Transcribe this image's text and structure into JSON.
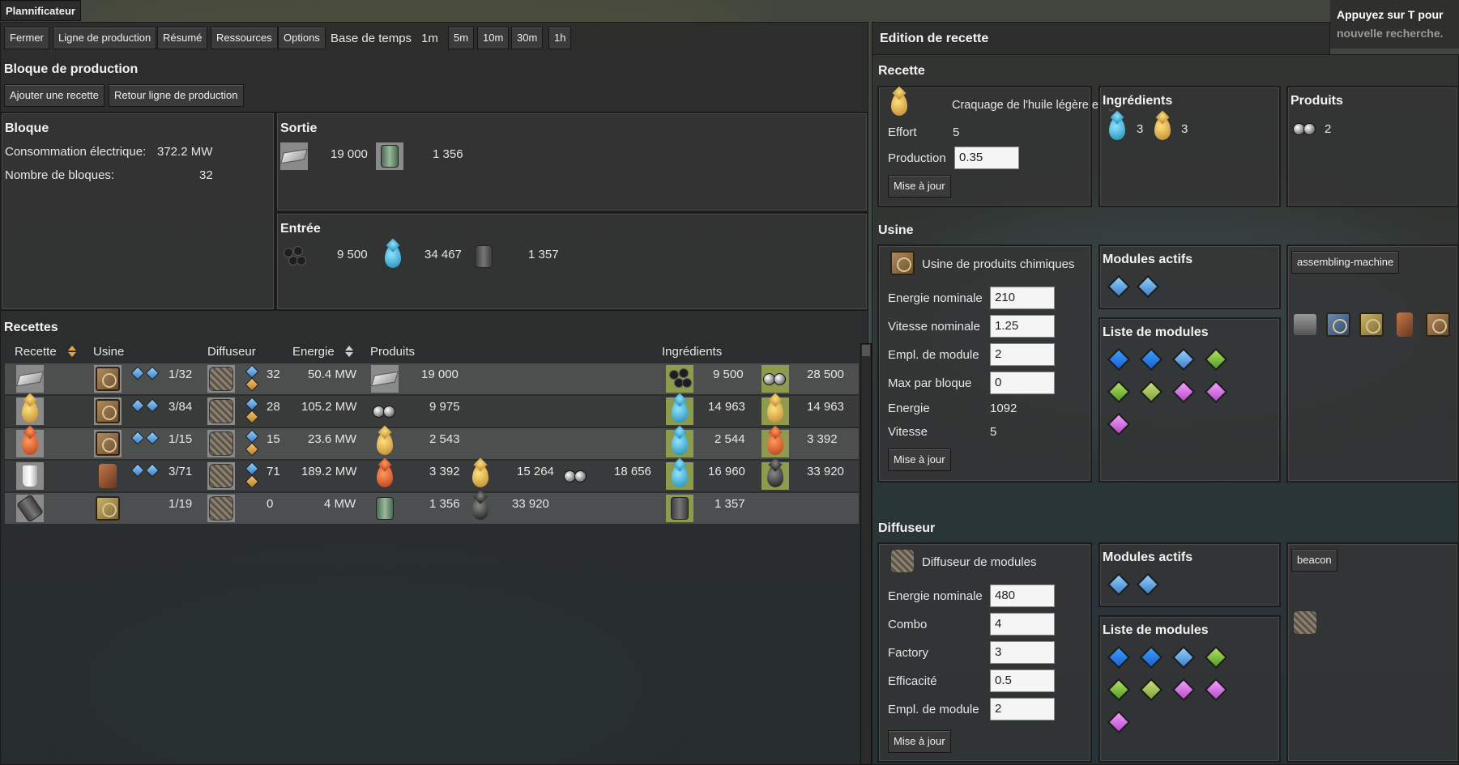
{
  "window": {
    "title": "Plannificateur"
  },
  "hint": {
    "line1": "Appuyez sur T pour",
    "line2": "nouvelle recherche."
  },
  "toolbar": {
    "close": "Fermer",
    "production_line": "Ligne de production",
    "summary": "Résumé",
    "resources": "Ressources",
    "options": "Options",
    "time_base_label": "Base de temps",
    "current_time": "1m",
    "times": [
      "5m",
      "10m",
      "30m",
      "1h"
    ]
  },
  "block_panel": {
    "title": "Bloque de production",
    "add_recipe": "Ajouter une recette",
    "back": "Retour ligne de production"
  },
  "bloque": {
    "title": "Bloque",
    "power_label": "Consommation électrique:",
    "power_value": "372.2 MW",
    "count_label": "Nombre de bloques:",
    "count_value": "32"
  },
  "sortie": {
    "title": "Sortie",
    "items": [
      {
        "icon": "iron-plate-icon",
        "value": "19 000"
      },
      {
        "icon": "sulfuric-barrel-icon",
        "value": "1 356"
      }
    ]
  },
  "entree": {
    "title": "Entrée",
    "items": [
      {
        "icon": "coal-icon",
        "value": "9 500"
      },
      {
        "icon": "water-icon",
        "value": "34 467"
      },
      {
        "icon": "barrel-icon",
        "value": "1 357"
      }
    ]
  },
  "recipes": {
    "title": "Recettes",
    "columns": {
      "recipe": "Recette",
      "factory": "Usine",
      "beacon": "Diffuseur",
      "energy": "Energie",
      "products": "Produits",
      "ingredients": "Ingrédients"
    },
    "rows": [
      {
        "count": "1/32",
        "beacons": "32",
        "energy": "50.4 MW",
        "products": [
          {
            "icon": "iron-plate-icon",
            "value": "19 000"
          }
        ],
        "ingredients": [
          {
            "icon": "coal-icon",
            "value": "9 500"
          },
          {
            "icon": "gas-icon",
            "value": "28 500"
          }
        ]
      },
      {
        "count": "3/84",
        "beacons": "28",
        "energy": "105.2 MW",
        "products": [
          {
            "icon": "gas-icon",
            "value": "9 975"
          }
        ],
        "ingredients": [
          {
            "icon": "water-icon",
            "value": "14 963"
          },
          {
            "icon": "light-oil-icon",
            "value": "14 963"
          }
        ]
      },
      {
        "count": "1/15",
        "beacons": "15",
        "energy": "23.6 MW",
        "products": [
          {
            "icon": "light-oil-icon",
            "value": "2 543"
          }
        ],
        "ingredients": [
          {
            "icon": "water-icon",
            "value": "2 544"
          },
          {
            "icon": "heavy-oil-icon",
            "value": "3 392"
          }
        ]
      },
      {
        "count": "3/71",
        "beacons": "71",
        "energy": "189.2 MW",
        "products": [
          {
            "icon": "heavy-oil-icon",
            "value": "3 392"
          },
          {
            "icon": "light-oil-icon",
            "value": "15 264"
          },
          {
            "icon": "gas-icon",
            "value": "18 656"
          }
        ],
        "ingredients": [
          {
            "icon": "water-icon",
            "value": "16 960"
          },
          {
            "icon": "crude-oil-icon",
            "value": "33 920"
          }
        ]
      },
      {
        "count": "1/19",
        "beacons": "0",
        "energy": "4 MW",
        "products": [
          {
            "icon": "barrel-icon",
            "value": "1 356"
          },
          {
            "icon": "crude-oil-icon",
            "value": "33 920"
          }
        ],
        "ingredients": [
          {
            "icon": "barrel-icon",
            "value": "1 357"
          }
        ]
      }
    ]
  },
  "edition": {
    "title": "Edition de recette"
  },
  "recette": {
    "title": "Recette",
    "name": "Craquage de l'huile légère en gaz naturel",
    "effort_label": "Effort",
    "effort_value": "5",
    "production_label": "Production",
    "production_value": "0.35",
    "update": "Mise à jour"
  },
  "ingredients_box": {
    "title": "Ingrédients",
    "items": [
      {
        "icon": "water-icon",
        "value": "3"
      },
      {
        "icon": "light-oil-icon",
        "value": "3"
      }
    ]
  },
  "produits_box": {
    "title": "Produits",
    "items": [
      {
        "icon": "gas-icon",
        "value": "2"
      }
    ]
  },
  "usine": {
    "title": "Usine",
    "name": "Usine de produits chimiques",
    "fields": [
      {
        "label": "Energie nominale",
        "value": "210"
      },
      {
        "label": "Vitesse nominale",
        "value": "1.25"
      },
      {
        "label": "Empl. de module",
        "value": "2"
      },
      {
        "label": "Max par bloque",
        "value": "0"
      }
    ],
    "energy_label": "Energie",
    "energy_value": "1092",
    "speed_label": "Vitesse",
    "speed_value": "5",
    "update": "Mise à jour",
    "active_modules": "Modules actifs",
    "module_list": "Liste de modules",
    "type_button": "assembling-machine"
  },
  "diffuseur": {
    "title": "Diffuseur",
    "name": "Diffuseur de modules",
    "fields": [
      {
        "label": "Energie nominale",
        "value": "480"
      },
      {
        "label": "Combo",
        "value": "4"
      },
      {
        "label": "Factory",
        "value": "3"
      },
      {
        "label": "Efficacité",
        "value": "0.5"
      },
      {
        "label": "Empl. de module",
        "value": "2"
      }
    ],
    "update": "Mise à jour",
    "active_modules": "Modules actifs",
    "module_list": "Liste de modules",
    "type_button": "beacon"
  }
}
